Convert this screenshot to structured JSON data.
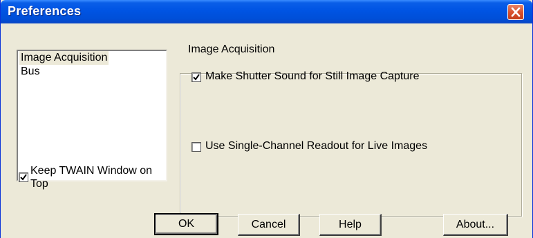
{
  "window": {
    "title": "Preferences",
    "close_icon": "close-icon"
  },
  "list": {
    "items": [
      {
        "label": "Image Acquisition",
        "selected": true
      },
      {
        "label": "Bus",
        "selected": false
      }
    ]
  },
  "keep_on_top": {
    "label_line1": "Keep TWAIN Window on",
    "label_line2": "Top",
    "checked": true
  },
  "group": {
    "title": "Image Acquisition",
    "options": [
      {
        "label": "Make Shutter Sound for Still Image Capture",
        "checked": true
      },
      {
        "label": "Use Single-Channel Readout for Live Images",
        "checked": false
      }
    ]
  },
  "buttons": {
    "ok": "OK",
    "cancel": "Cancel",
    "help": "Help",
    "about": "About..."
  },
  "colors": {
    "titlebar": "#0054e3",
    "dialog_bg": "#ece9d8",
    "close": "#d9522e"
  }
}
